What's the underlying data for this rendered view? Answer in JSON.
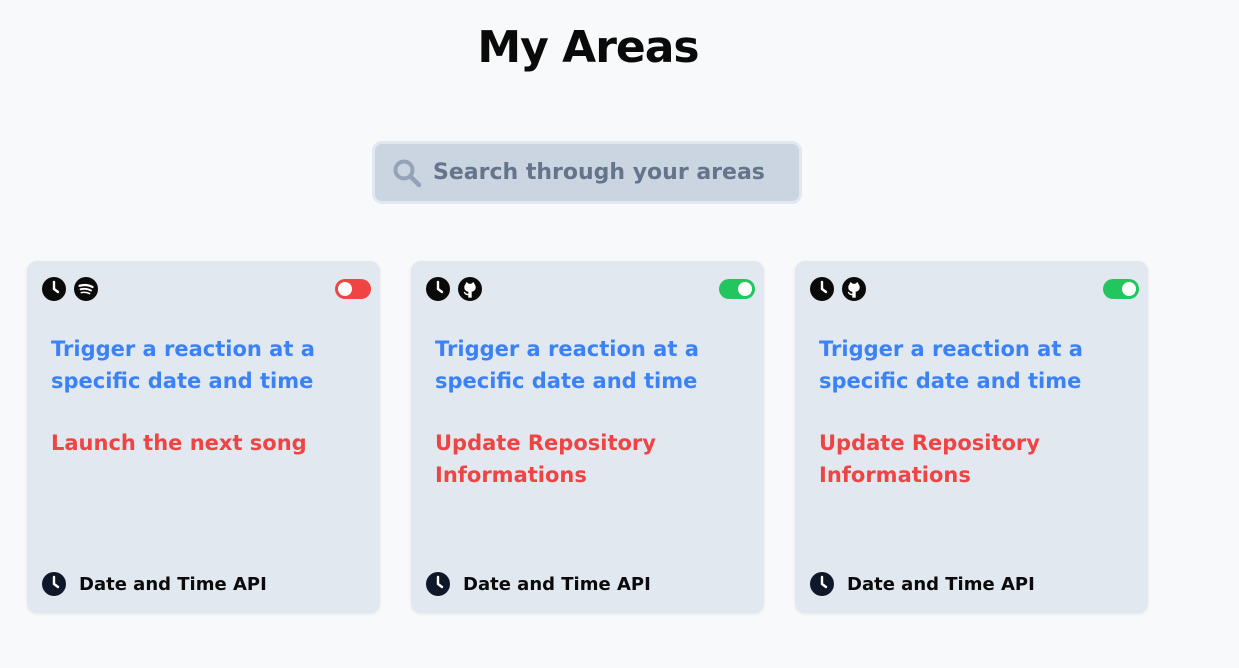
{
  "page": {
    "title": "My Areas"
  },
  "search": {
    "placeholder": "Search through your areas",
    "value": ""
  },
  "colors": {
    "action": "#3b82f6",
    "reaction": "#ef4444",
    "toggle_on": "#22c55e",
    "toggle_off": "#ef4444"
  },
  "cards": [
    {
      "icons": [
        "clock-icon",
        "spotify-icon"
      ],
      "enabled": false,
      "action": "Trigger a reaction at a specific date and time",
      "reaction": "Launch the next song",
      "service": "Date and Time API",
      "service_icon": "clock-icon"
    },
    {
      "icons": [
        "clock-icon",
        "github-icon"
      ],
      "enabled": true,
      "action": "Trigger a reaction at a specific date and time",
      "reaction": "Update Repository Informations",
      "service": "Date and Time API",
      "service_icon": "clock-icon"
    },
    {
      "icons": [
        "clock-icon",
        "github-icon"
      ],
      "enabled": true,
      "action": "Trigger a reaction at a specific date and time",
      "reaction": "Update Repository Informations",
      "service": "Date and Time API",
      "service_icon": "clock-icon"
    }
  ]
}
